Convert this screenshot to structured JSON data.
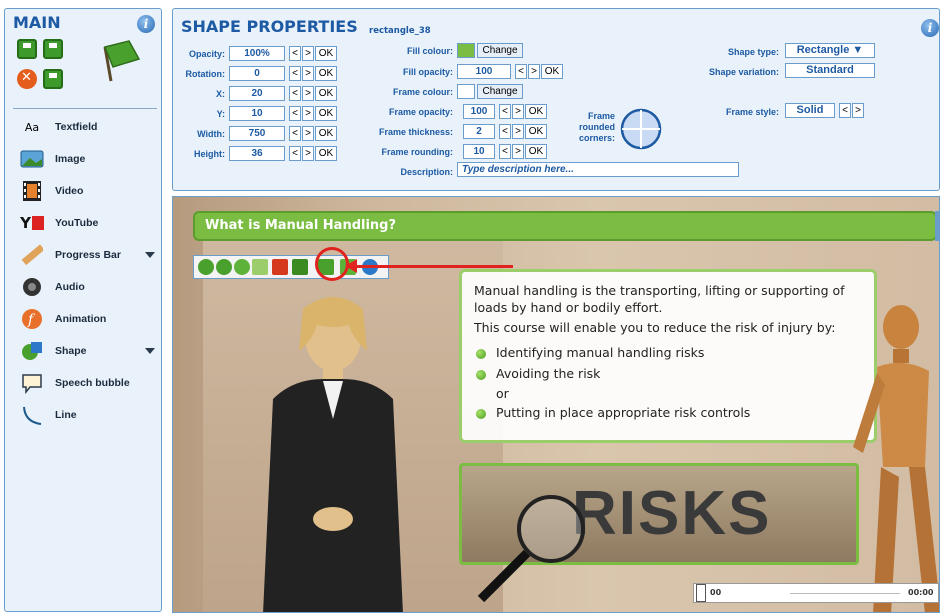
{
  "left_panel": {
    "title": "MAIN",
    "tools": [
      {
        "label": "Textfield",
        "icon": "textfield-icon"
      },
      {
        "label": "Image",
        "icon": "image-icon"
      },
      {
        "label": "Video",
        "icon": "video-icon"
      },
      {
        "label": "YouTube",
        "icon": "youtube-icon"
      },
      {
        "label": "Progress Bar",
        "icon": "progress-bar-icon",
        "has_dropdown": true
      },
      {
        "label": "Audio",
        "icon": "audio-icon"
      },
      {
        "label": "Animation",
        "icon": "animation-icon"
      },
      {
        "label": "Shape",
        "icon": "shape-icon",
        "has_dropdown": true
      },
      {
        "label": "Speech bubble",
        "icon": "speech-bubble-icon"
      },
      {
        "label": "Line",
        "icon": "line-icon"
      }
    ],
    "icon_textfield": "Aa",
    "icon_youtube": "Y"
  },
  "properties": {
    "title": "SHAPE PROPERTIES",
    "object_name": "rectangle_38",
    "opacity_label": "Opacity:",
    "opacity_value": "100%",
    "rotation_label": "Rotation:",
    "rotation_value": "0",
    "x_label": "X:",
    "x_value": "20",
    "y_label": "Y:",
    "y_value": "10",
    "width_label": "Width:",
    "width_value": "750",
    "height_label": "Height:",
    "height_value": "36",
    "fill_colour_label": "Fill colour:",
    "fill_colour": "#7bbd43",
    "change_label": "Change",
    "fill_opacity_label": "Fill opacity:",
    "fill_opacity_value": "100",
    "frame_colour_label": "Frame colour:",
    "frame_colour": "#ffffff",
    "frame_opacity_label": "Frame opacity:",
    "frame_opacity_value": "100",
    "frame_thickness_label": "Frame thickness:",
    "frame_thickness_value": "2",
    "frame_rounding_label": "Frame rounding:",
    "frame_rounding_value": "10",
    "frame_rounded_corners_label": "Frame rounded corners:",
    "description_label": "Description:",
    "description_placeholder": "Type description here...",
    "shape_type_label": "Shape type:",
    "shape_type_value": "Rectangle",
    "shape_variation_label": "Shape variation:",
    "shape_variation_value": "Standard",
    "frame_style_label": "Frame style:",
    "frame_style_value": "Solid",
    "dec": "<",
    "inc": ">",
    "ok": "OK"
  },
  "stage": {
    "title": "What is Manual Handling?",
    "intro": "Manual handling is the transporting, lifting or supporting of loads by hand or bodily effort.",
    "intro2": "This course will enable you to reduce the risk of injury by:",
    "bullets": [
      "Identifying manual handling risks",
      "Avoiding the risk",
      "Putting in place appropriate risk controls"
    ],
    "or_text": "or",
    "risks_word": "RISKS",
    "progress_left": "00",
    "progress_right": "00:00"
  },
  "colors": {
    "accent_green": "#7bbd43",
    "panel_blue": "#1d5aa3",
    "highlight_red": "#e0231f"
  }
}
